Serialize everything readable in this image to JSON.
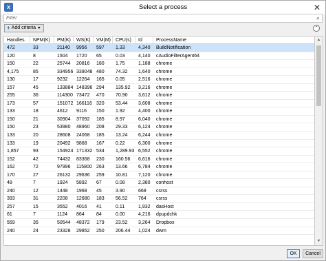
{
  "window": {
    "title": "Select a process",
    "app_icon": "x",
    "close_glyph": "✕"
  },
  "filter": {
    "placeholder": "Filter",
    "search_icon": "⌕"
  },
  "criteria": {
    "add_label": "Add criteria",
    "collapse_glyph": "⌃"
  },
  "table": {
    "columns": [
      "Handles",
      "NPM(K)",
      "PM(K)",
      "WS(K)",
      "VM(M)",
      "CPU(s)",
      "Id",
      "ProcessName"
    ],
    "rows": [
      [
        "472",
        "33",
        "21140",
        "9956",
        "597",
        "1.33",
        "4,340",
        "BuildNotification"
      ],
      [
        "120",
        "8",
        "1504",
        "1720",
        "65",
        "0.03",
        "4,140",
        "cAudioFilterAgent64"
      ],
      [
        "150",
        "22",
        "25744",
        "20816",
        "180",
        "1.75",
        "1,188",
        "chrome"
      ],
      [
        "4,175",
        "85",
        "334956",
        "339048",
        "480",
        "74.32",
        "1,640",
        "chrome"
      ],
      [
        "130",
        "17",
        "9232",
        "12264",
        "165",
        "0.05",
        "2,516",
        "chrome"
      ],
      [
        "157",
        "45",
        "133884",
        "148396",
        "294",
        "135.92",
        "3,216",
        "chrome"
      ],
      [
        "255",
        "36",
        "114300",
        "73472",
        "470",
        "70.90",
        "3,612",
        "chrome"
      ],
      [
        "173",
        "57",
        "151072",
        "166116",
        "320",
        "53.44",
        "3,608",
        "chrome"
      ],
      [
        "133",
        "18",
        "4612",
        "9116",
        "150",
        "1.92",
        "4,400",
        "chrome"
      ],
      [
        "150",
        "21",
        "30904",
        "37092",
        "185",
        "8.97",
        "6,040",
        "chrome"
      ],
      [
        "150",
        "23",
        "53980",
        "48960",
        "208",
        "29.33",
        "6,124",
        "chrome"
      ],
      [
        "133",
        "20",
        "28608",
        "24068",
        "185",
        "13.24",
        "6,244",
        "chrome"
      ],
      [
        "133",
        "19",
        "20492",
        "9868",
        "167",
        "0.22",
        "6,300",
        "chrome"
      ],
      [
        "1,857",
        "93",
        "154924",
        "171332",
        "534",
        "1,289.93",
        "6,552",
        "chrome"
      ],
      [
        "152",
        "42",
        "74432",
        "83368",
        "230",
        "160.56",
        "6,616",
        "chrome"
      ],
      [
        "162",
        "72",
        "97996",
        "115800",
        "263",
        "13.66",
        "6,784",
        "chrome"
      ],
      [
        "170",
        "27",
        "26132",
        "29636",
        "259",
        "10.81",
        "7,120",
        "chrome"
      ],
      [
        "48",
        "7",
        "1924",
        "5892",
        "67",
        "0.08",
        "2,380",
        "conhost"
      ],
      [
        "240",
        "12",
        "1448",
        "1968",
        "45",
        "3.90",
        "668",
        "csrss"
      ],
      [
        "393",
        "31",
        "2208",
        "12680",
        "183",
        "56.52",
        "764",
        "csrss"
      ],
      [
        "257",
        "15",
        "3552",
        "4016",
        "41",
        "0.11",
        "1,932",
        "dasHost"
      ],
      [
        "61",
        "7",
        "1124",
        "864",
        "84",
        "0.00",
        "4,216",
        "dpupdchk"
      ],
      [
        "559",
        "35",
        "50544",
        "48372",
        "179",
        "23.52",
        "3,264",
        "Dropbox"
      ],
      [
        "240",
        "24",
        "23328",
        "29852",
        "250",
        "206.44",
        "1,024",
        "dwm"
      ]
    ],
    "selected_row": 0
  },
  "scrollbar": {
    "up_glyph": "▲",
    "down_glyph": "▼"
  },
  "buttons": {
    "ok": "OK",
    "cancel": "Cancel"
  }
}
